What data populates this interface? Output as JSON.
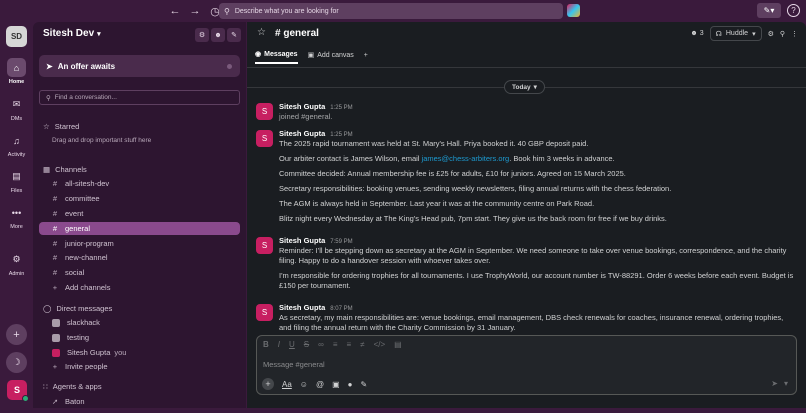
{
  "topbar": {
    "search_placeholder": "Describe what you are looking for"
  },
  "workspace": {
    "initials": "SD",
    "name": "Sitesh Dev"
  },
  "rail": {
    "items": [
      {
        "label": "Home"
      },
      {
        "label": "DMs"
      },
      {
        "label": "Activity"
      },
      {
        "label": "Files"
      },
      {
        "label": "More"
      },
      {
        "label": "Admin"
      }
    ],
    "user_initial": "S"
  },
  "sidebar": {
    "offer": "An offer awaits",
    "find_placeholder": "Find a conversation...",
    "starred": {
      "title": "Starred",
      "note": "Drag and drop important stuff here"
    },
    "channels_title": "Channels",
    "channels": [
      {
        "name": "all-sitesh-dev"
      },
      {
        "name": "committee"
      },
      {
        "name": "event"
      },
      {
        "name": "general"
      },
      {
        "name": "junior-program"
      },
      {
        "name": "new-channel"
      },
      {
        "name": "social"
      }
    ],
    "add_channels": "Add channels",
    "dm_title": "Direct messages",
    "dms": [
      {
        "name": "slackhack",
        "suffix": ""
      },
      {
        "name": "testing",
        "suffix": ""
      },
      {
        "name": "Sitesh Gupta",
        "suffix": "you"
      }
    ],
    "invite": "Invite people",
    "agents_title": "Agents & apps",
    "agents": [
      {
        "name": "Baton"
      }
    ]
  },
  "channel": {
    "name": "# general",
    "member_count": "3",
    "huddle_label": "Huddle",
    "tabs": [
      {
        "label": "Messages"
      },
      {
        "label": "Add canvas"
      }
    ],
    "date_divider": "Today"
  },
  "messages": [
    {
      "author": "Sitesh Gupta",
      "time": "1:25 PM",
      "initial": "S",
      "lines": [
        "joined #general."
      ]
    },
    {
      "author": "Sitesh Gupta",
      "time": "1:25 PM",
      "initial": "S",
      "line1": "The 2025 rapid tournament was held at St. Mary's Hall. Priya booked it. 40 GBP deposit paid.",
      "line2_pre": "Our arbiter contact is James Wilson, email ",
      "line2_link": "james@chess-arbiters.org",
      "line2_post": ". Book him 3 weeks in advance.",
      "line3": "Committee decided: Annual membership fee is £25 for adults, £10 for juniors. Agreed on 15 March 2025.",
      "line4": "Secretary responsibilities: booking venues, sending weekly newsletters, filing annual returns with the chess federation.",
      "line5": "The AGM is always held in September. Last year it was at the community centre on Park Road.",
      "line6": "Blitz night every Wednesday at The King's Head pub, 7pm start. They give us the back room for free if we buy drinks."
    },
    {
      "author": "Sitesh Gupta",
      "time": "7:59 PM",
      "initial": "S",
      "line1": "Reminder: I'll be stepping down as secretary at the AGM in September. We need someone to take over venue bookings, correspondence, and the charity filing. Happy to do a handover session with whoever takes over.",
      "line2": "I'm responsible for ordering trophies for all tournaments. I use TrophyWorld, our account number is TW-88291. Order 6 weeks before each event. Budget is £150 per tournament."
    },
    {
      "author": "Sitesh Gupta",
      "time": "8:07 PM",
      "initial": "S",
      "line1": "As secretary, my main responsibilities are: venue bookings, email management, DBS check renewals for coaches, insurance renewal, ordering trophies, and filing the annual return with the Charity Commission by 31 January."
    }
  ],
  "composer": {
    "placeholder": "Message #general",
    "aa_label": "Aa"
  }
}
